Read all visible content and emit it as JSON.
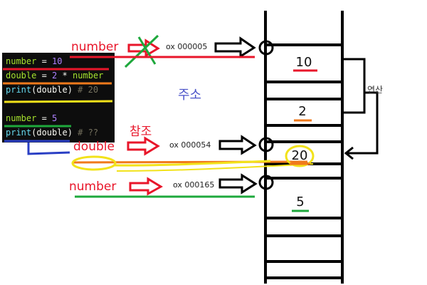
{
  "code": {
    "lines": [
      [
        {
          "t": "number",
          "c": "c-kw"
        },
        {
          "t": " = ",
          "c": "c-op"
        },
        {
          "t": "10",
          "c": "c-num"
        }
      ],
      [
        {
          "t": "double",
          "c": "c-kw"
        },
        {
          "t": " = ",
          "c": "c-op"
        },
        {
          "t": "2",
          "c": "c-num"
        },
        {
          "t": " * ",
          "c": "c-op"
        },
        {
          "t": "number",
          "c": "c-kw"
        }
      ],
      [
        {
          "t": "print",
          "c": "c-fn"
        },
        {
          "t": "(double)",
          "c": "c-txt"
        },
        {
          "t": " # 20",
          "c": "c-cmt"
        }
      ],
      [],
      [
        {
          "t": "number",
          "c": "c-kw"
        },
        {
          "t": " = ",
          "c": "c-op"
        },
        {
          "t": "5",
          "c": "c-num"
        }
      ],
      [
        {
          "t": "print",
          "c": "c-fn"
        },
        {
          "t": "(double)",
          "c": "c-txt"
        },
        {
          "t": " # ??",
          "c": "c-cmt"
        }
      ]
    ]
  },
  "labels": {
    "number_top": "number",
    "addr_1": "ox 000005",
    "address_title": "주소",
    "reference": "참조",
    "double": "double",
    "addr_2": "ox 000054",
    "number_bottom": "number",
    "addr_3": "ox 000165",
    "operation": "연산"
  },
  "memory": {
    "values": [
      "10",
      "2",
      "20",
      "5"
    ]
  }
}
